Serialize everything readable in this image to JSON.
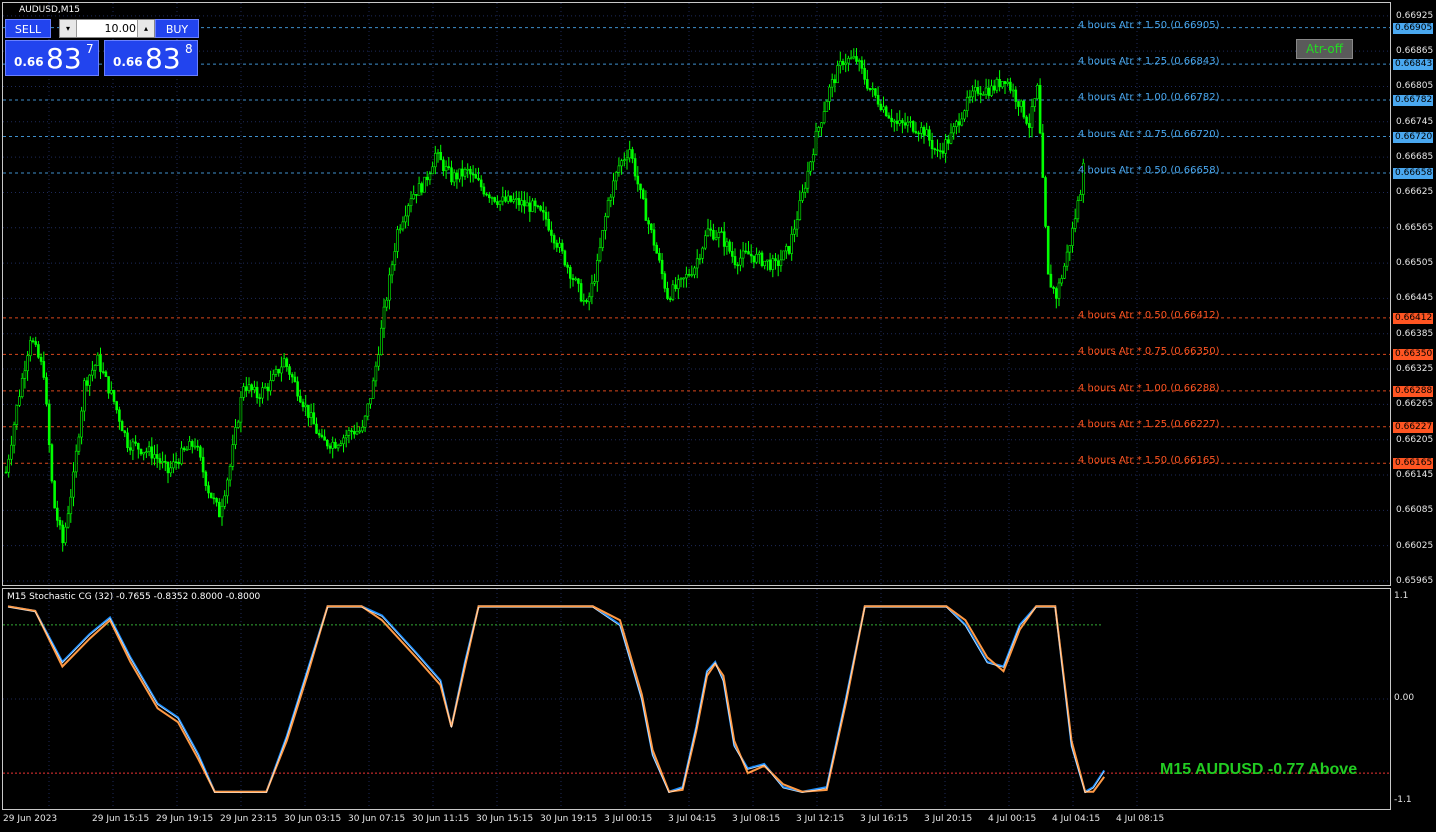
{
  "window": {
    "title": "AUDUSD,M15"
  },
  "trade_panel": {
    "sell_label": "SELL",
    "buy_label": "BUY",
    "lot_value": "10.00",
    "sell_price": {
      "prefix": "0.66",
      "big": "83",
      "sup": "7"
    },
    "buy_price": {
      "prefix": "0.66",
      "big": "83",
      "sup": "8"
    }
  },
  "atr_button": {
    "label": "Atr-off"
  },
  "price_axis": {
    "labels": [
      "0.66925",
      "0.66865",
      "0.66805",
      "0.66745",
      "0.66685",
      "0.66625",
      "0.66565",
      "0.66505",
      "0.66445",
      "0.66385",
      "0.66325",
      "0.66265",
      "0.66205",
      "0.66145",
      "0.66085",
      "0.66025",
      "0.65965"
    ],
    "range": [
      0.65965,
      0.6694
    ]
  },
  "atr_levels": {
    "upper": [
      {
        "label": "4 hours Atr * 1.50 (0.66905)",
        "tag": "0.66905",
        "price": 0.66905
      },
      {
        "label": "4 hours Atr * 1.25 (0.66843)",
        "tag": "0.66843",
        "price": 0.66843
      },
      {
        "label": "4 hours Atr * 1.00 (0.66782)",
        "tag": "0.66782",
        "price": 0.66782
      },
      {
        "label": "4 hours Atr * 0.75 (0.66720)",
        "tag": "0.66720",
        "price": 0.6672
      },
      {
        "label": "4 hours Atr * 0.50 (0.66658)",
        "tag": "0.66658",
        "price": 0.66658
      }
    ],
    "lower": [
      {
        "label": "4 hours Atr * 0.50 (0.66412)",
        "tag": "0.66412",
        "price": 0.66412
      },
      {
        "label": "4 hours Atr * 0.75 (0.66350)",
        "tag": "0.66350",
        "price": 0.6635
      },
      {
        "label": "4 hours Atr * 1.00 (0.66288)",
        "tag": "0.66288",
        "price": 0.66288
      },
      {
        "label": "4 hours Atr * 1.25 (0.66227)",
        "tag": "0.66227",
        "price": 0.66227
      },
      {
        "label": "4 hours Atr * 1.50 (0.66165)",
        "tag": "0.66165",
        "price": 0.66165
      }
    ],
    "upper_color": "#4aa8f0",
    "lower_color": "#ff5522"
  },
  "time_axis": {
    "labels": [
      "29 Jun 2023",
      "29 Jun 15:15",
      "29 Jun 19:15",
      "29 Jun 23:15",
      "30 Jun 03:15",
      "30 Jun 07:15",
      "30 Jun 11:15",
      "30 Jun 15:15",
      "30 Jun 19:15",
      "3 Jul 00:15",
      "3 Jul 04:15",
      "3 Jul 08:15",
      "3 Jul 12:15",
      "3 Jul 16:15",
      "3 Jul 20:15",
      "4 Jul 00:15",
      "4 Jul 04:15",
      "4 Jul 08:15"
    ]
  },
  "indicator": {
    "title": "M15 Stochastic CG (32) -0.7655 -0.8352 0.8000 -0.8000",
    "axis_labels": [
      "1.1",
      "0.00",
      "-1.1"
    ],
    "levels": [
      0.8,
      -0.8
    ],
    "status_text": "M15 AUDUSD -0.77 Above"
  },
  "chart_data": [
    {
      "type": "candlestick",
      "title": "AUDUSD,M15",
      "ylim": [
        0.65965,
        0.6694
      ],
      "close_path": [
        [
          0,
          0.6615
        ],
        [
          8,
          0.6626
        ],
        [
          18,
          0.6638
        ],
        [
          28,
          0.6632
        ],
        [
          35,
          0.661
        ],
        [
          42,
          0.6603
        ],
        [
          50,
          0.6614
        ],
        [
          58,
          0.663
        ],
        [
          68,
          0.6634
        ],
        [
          80,
          0.6627
        ],
        [
          90,
          0.662
        ],
        [
          100,
          0.6619
        ],
        [
          110,
          0.6618
        ],
        [
          120,
          0.6615
        ],
        [
          130,
          0.6618
        ],
        [
          140,
          0.662
        ],
        [
          150,
          0.6612
        ],
        [
          158,
          0.6608
        ],
        [
          166,
          0.6616
        ],
        [
          176,
          0.663
        ],
        [
          186,
          0.6628
        ],
        [
          196,
          0.663
        ],
        [
          206,
          0.6634
        ],
        [
          214,
          0.663
        ],
        [
          224,
          0.6625
        ],
        [
          234,
          0.662
        ],
        [
          244,
          0.662
        ],
        [
          256,
          0.6622
        ],
        [
          264,
          0.6622
        ],
        [
          272,
          0.663
        ],
        [
          280,
          0.6642
        ],
        [
          290,
          0.6656
        ],
        [
          300,
          0.6662
        ],
        [
          310,
          0.6664
        ],
        [
          318,
          0.6669
        ],
        [
          330,
          0.6665
        ],
        [
          342,
          0.6666
        ],
        [
          354,
          0.6663
        ],
        [
          366,
          0.6661
        ],
        [
          376,
          0.6661
        ],
        [
          390,
          0.666
        ],
        [
          400,
          0.6658
        ],
        [
          410,
          0.6653
        ],
        [
          420,
          0.6648
        ],
        [
          430,
          0.6643
        ],
        [
          438,
          0.665
        ],
        [
          446,
          0.6661
        ],
        [
          454,
          0.6667
        ],
        [
          462,
          0.667
        ],
        [
          470,
          0.6662
        ],
        [
          480,
          0.6654
        ],
        [
          490,
          0.6645
        ],
        [
          500,
          0.6647
        ],
        [
          510,
          0.665
        ],
        [
          520,
          0.6656
        ],
        [
          530,
          0.6655
        ],
        [
          540,
          0.6651
        ],
        [
          550,
          0.6652
        ],
        [
          560,
          0.6651
        ],
        [
          570,
          0.665
        ],
        [
          580,
          0.6653
        ],
        [
          590,
          0.6662
        ],
        [
          600,
          0.6672
        ],
        [
          610,
          0.668
        ],
        [
          620,
          0.6685
        ],
        [
          630,
          0.6685
        ],
        [
          640,
          0.668
        ],
        [
          650,
          0.6677
        ],
        [
          660,
          0.6674
        ],
        [
          670,
          0.6674
        ],
        [
          680,
          0.6673
        ],
        [
          690,
          0.6669
        ],
        [
          700,
          0.6672
        ],
        [
          710,
          0.6677
        ],
        [
          720,
          0.668
        ],
        [
          730,
          0.668
        ],
        [
          740,
          0.6682
        ],
        [
          750,
          0.6678
        ],
        [
          758,
          0.6674
        ],
        [
          764,
          0.668
        ],
        [
          772,
          0.6648
        ],
        [
          778,
          0.6645
        ],
        [
          784,
          0.665
        ],
        [
          790,
          0.6656
        ],
        [
          796,
          0.6663
        ],
        [
          800,
          0.6674
        ]
      ],
      "bounds_note": ""
    },
    {
      "type": "line",
      "title": "M15 Stochastic CG (32) -0.7655 -0.8352 0.8000 -0.8000",
      "ylim": [
        -1.1,
        1.1
      ],
      "series": [
        {
          "color": "#1e90ff",
          "values": [
            [
              0,
              1.0
            ],
            [
              20,
              0.95
            ],
            [
              40,
              0.4
            ],
            [
              60,
              0.7
            ],
            [
              75,
              0.88
            ],
            [
              90,
              0.45
            ],
            [
              110,
              -0.05
            ],
            [
              125,
              -0.2
            ],
            [
              140,
              -0.6
            ],
            [
              152,
              -1.0
            ],
            [
              190,
              -1.0
            ],
            [
              205,
              -0.4
            ],
            [
              220,
              0.3
            ],
            [
              235,
              1.0
            ],
            [
              260,
              1.0
            ],
            [
              275,
              0.9
            ],
            [
              300,
              0.5
            ],
            [
              318,
              0.2
            ],
            [
              326,
              -0.3
            ],
            [
              336,
              0.4
            ],
            [
              346,
              1.0
            ],
            [
              430,
              1.0
            ],
            [
              450,
              0.8
            ],
            [
              466,
              0.0
            ],
            [
              474,
              -0.6
            ],
            [
              486,
              -1.0
            ],
            [
              496,
              -0.95
            ],
            [
              506,
              -0.3
            ],
            [
              514,
              0.3
            ],
            [
              520,
              0.4
            ],
            [
              526,
              0.2
            ],
            [
              534,
              -0.5
            ],
            [
              544,
              -0.75
            ],
            [
              556,
              -0.7
            ],
            [
              570,
              -0.95
            ],
            [
              584,
              -1.0
            ],
            [
              602,
              -0.95
            ],
            [
              616,
              0.0
            ],
            [
              630,
              1.0
            ],
            [
              690,
              1.0
            ],
            [
              704,
              0.8
            ],
            [
              720,
              0.4
            ],
            [
              732,
              0.35
            ],
            [
              744,
              0.8
            ],
            [
              756,
              1.0
            ],
            [
              770,
              1.0
            ],
            [
              782,
              -0.5
            ],
            [
              792,
              -1.0
            ],
            [
              798,
              -0.95
            ],
            [
              806,
              -0.77
            ]
          ]
        },
        {
          "color": "#ff9944",
          "values": [
            [
              0,
              1.0
            ],
            [
              20,
              0.95
            ],
            [
              40,
              0.35
            ],
            [
              60,
              0.65
            ],
            [
              75,
              0.85
            ],
            [
              90,
              0.4
            ],
            [
              110,
              -0.1
            ],
            [
              125,
              -0.25
            ],
            [
              140,
              -0.65
            ],
            [
              152,
              -1.0
            ],
            [
              190,
              -1.0
            ],
            [
              205,
              -0.45
            ],
            [
              220,
              0.25
            ],
            [
              235,
              1.0
            ],
            [
              260,
              1.0
            ],
            [
              275,
              0.85
            ],
            [
              300,
              0.45
            ],
            [
              318,
              0.15
            ],
            [
              326,
              -0.3
            ],
            [
              336,
              0.35
            ],
            [
              346,
              1.0
            ],
            [
              430,
              1.0
            ],
            [
              450,
              0.85
            ],
            [
              466,
              0.05
            ],
            [
              474,
              -0.55
            ],
            [
              486,
              -1.0
            ],
            [
              496,
              -0.98
            ],
            [
              506,
              -0.35
            ],
            [
              514,
              0.25
            ],
            [
              520,
              0.38
            ],
            [
              526,
              0.25
            ],
            [
              534,
              -0.45
            ],
            [
              544,
              -0.8
            ],
            [
              556,
              -0.72
            ],
            [
              570,
              -0.92
            ],
            [
              584,
              -1.0
            ],
            [
              602,
              -0.98
            ],
            [
              616,
              -0.05
            ],
            [
              630,
              1.0
            ],
            [
              690,
              1.0
            ],
            [
              704,
              0.85
            ],
            [
              720,
              0.45
            ],
            [
              732,
              0.3
            ],
            [
              744,
              0.75
            ],
            [
              756,
              1.0
            ],
            [
              770,
              1.0
            ],
            [
              782,
              -0.45
            ],
            [
              792,
              -1.0
            ],
            [
              798,
              -1.0
            ],
            [
              806,
              -0.84
            ]
          ]
        }
      ]
    }
  ]
}
